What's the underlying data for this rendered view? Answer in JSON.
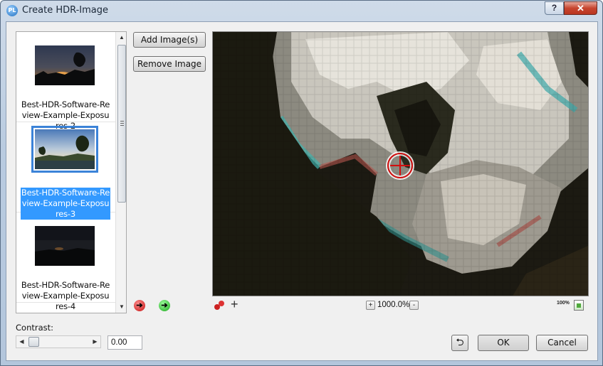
{
  "window": {
    "title": "Create HDR-Image",
    "app_icon": "PL",
    "help_label": "?",
    "close_label": "✕"
  },
  "image_list": {
    "items": [
      {
        "label": "Best-HDR-Software-Review-Example-Exposures-2",
        "selected": false
      },
      {
        "label": "Best-HDR-Software-Review-Example-Exposures-3",
        "selected": true
      },
      {
        "label": "Best-HDR-Software-Review-Example-Exposures-4",
        "selected": false
      }
    ]
  },
  "buttons": {
    "add": "Add Image(s)",
    "remove": "Remove Image",
    "ok": "OK",
    "cancel": "Cancel",
    "undo_icon": "undo-icon"
  },
  "navigation": {
    "prev_icon": "arrow-left-red-icon",
    "next_icon": "arrow-right-green-icon"
  },
  "preview": {
    "zoom": "1000.0%",
    "zoom_plus": "+",
    "zoom_minus": "-",
    "fit_label": "100%",
    "tools": [
      "marker-icon",
      "add-point-icon"
    ]
  },
  "contrast": {
    "label": "Contrast:",
    "value": "0.00"
  },
  "colors": {
    "selection": "#3399ff",
    "preview_bg": "#1c1a12",
    "crosshair": "#d20f0f"
  }
}
